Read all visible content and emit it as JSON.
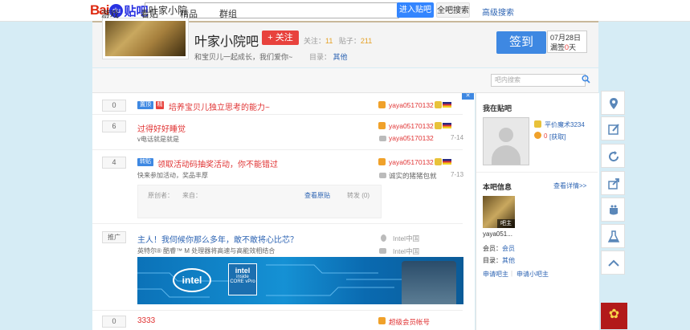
{
  "topbar": {
    "logo_bai": "Bai",
    "logo_du": "du",
    "logo_tieba": "贴吧",
    "search_value": "叶家小院",
    "enter_button": "进入贴吧",
    "all_search_button": "全吧搜索",
    "advanced_search": "高级搜索"
  },
  "forum": {
    "name": "叶家小院吧",
    "follow_button": "+ 关注",
    "follow_label": "关注：",
    "follow_count": "11",
    "posts_label": "贴子：",
    "posts_count": "211",
    "slogan": "和宝贝儿一起成长，我们爱你~",
    "catalog_label": "目录：",
    "catalog_value": "其他",
    "sign_button": "签到",
    "sign_date": "07月28日",
    "sign_streak_prefix": "漏签",
    "sign_streak_count": "0",
    "sign_streak_suffix": "天"
  },
  "nav": {
    "tabs": [
      "游戏",
      "看贴",
      "精品",
      "群组"
    ],
    "search_placeholder": "吧内搜索"
  },
  "threads": [
    {
      "replies": "0",
      "badges": [
        "置顶",
        "精"
      ],
      "title": "培养宝贝儿独立思考的能力~",
      "author": "yaya05170132",
      "sub": "",
      "last_reply": "",
      "last_time": ""
    },
    {
      "replies": "6",
      "badges": [],
      "title": "过得好好睡觉",
      "author": "yaya05170132",
      "sub": "v电话就是就是",
      "last_reply": "yaya05170132",
      "last_time": "7-14"
    },
    {
      "replies": "4",
      "badges": [
        "转贴"
      ],
      "title": "领取活动码抽奖活动，你不能错过",
      "author": "yaya05170132",
      "sub": "快来参加活动，奖品丰厚",
      "last_reply": "诚实的猪猪包就",
      "last_time": "7-13"
    },
    {
      "replies": "推广",
      "badges": [],
      "title": "主人！我伺候你那么多年，敢不敢将心比芯？",
      "author": "Intel中国",
      "sub": "英特尔® 酷睿™ M 处理器将高速与高能效相结合",
      "last_reply": "Intel中国",
      "last_time": ""
    },
    {
      "replies": "0",
      "badges": [],
      "title": "3333",
      "author": "超级会员帐号",
      "sub": "",
      "last_reply": "",
      "last_time": ""
    }
  ],
  "quote": {
    "original_author": "原创者：",
    "source": "来自：",
    "view_original": "查看原贴",
    "repost": "转发 (0)"
  },
  "ad": {
    "brand": "intel",
    "chip_brand": "intel",
    "chip_line1": "inside",
    "chip_line2": "CORE vPro"
  },
  "sidebar": {
    "in_forum_title": "我在贴吧",
    "user_name": "平价魔术3234",
    "user_coins": "0",
    "user_get": "[获取]",
    "info_title": "本吧信息",
    "view_details": "查看详情>>",
    "owner_tag": "吧主",
    "owner_name": "yaya051...",
    "member_label": "会员：",
    "member_value": "会员",
    "catalog_label": "目录：",
    "catalog_value": "其他",
    "apply_owner": "申请吧主",
    "separator": "|",
    "apply_small_owner": "申请小吧主"
  },
  "colors": {
    "accent": "#3e88e2",
    "red": "#e03333",
    "link": "#2d64b3"
  }
}
